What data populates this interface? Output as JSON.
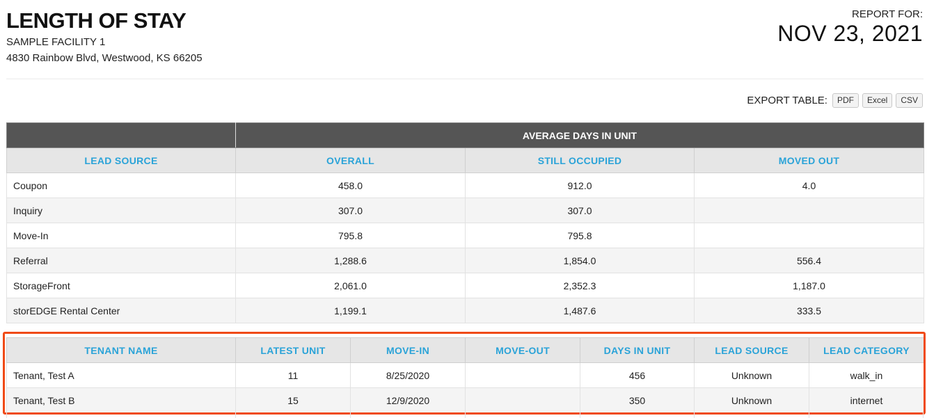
{
  "report": {
    "title": "LENGTH OF STAY",
    "facility": "SAMPLE FACILITY 1",
    "address": "4830 Rainbow Blvd, Westwood, KS 66205",
    "report_for_label": "REPORT FOR:",
    "report_date": "NOV 23, 2021"
  },
  "export": {
    "label": "EXPORT TABLE:",
    "pdf": "PDF",
    "excel": "Excel",
    "csv": "CSV"
  },
  "summary_table": {
    "group_header": "AVERAGE DAYS IN UNIT",
    "columns": [
      "LEAD SOURCE",
      "OVERALL",
      "STILL OCCUPIED",
      "MOVED OUT"
    ],
    "rows": [
      [
        "Coupon",
        "458.0",
        "912.0",
        "4.0"
      ],
      [
        "Inquiry",
        "307.0",
        "307.0",
        ""
      ],
      [
        "Move-In",
        "795.8",
        "795.8",
        ""
      ],
      [
        "Referral",
        "1,288.6",
        "1,854.0",
        "556.4"
      ],
      [
        "StorageFront",
        "2,061.0",
        "2,352.3",
        "1,187.0"
      ],
      [
        "storEDGE Rental Center",
        "1,199.1",
        "1,487.6",
        "333.5"
      ]
    ]
  },
  "tenant_table": {
    "columns": [
      "TENANT NAME",
      "LATEST UNIT",
      "MOVE-IN",
      "MOVE-OUT",
      "DAYS IN UNIT",
      "LEAD SOURCE",
      "LEAD CATEGORY"
    ],
    "rows": [
      [
        "Tenant, Test A",
        "11",
        "8/25/2020",
        "",
        "456",
        "Unknown",
        "walk_in"
      ],
      [
        "Tenant, Test B",
        "15",
        "12/9/2020",
        "",
        "350",
        "Unknown",
        "internet"
      ]
    ]
  },
  "colors": {
    "header_dark": "#555555",
    "header_text_accent": "#2aa3d8",
    "highlight_border": "#f04a16"
  }
}
